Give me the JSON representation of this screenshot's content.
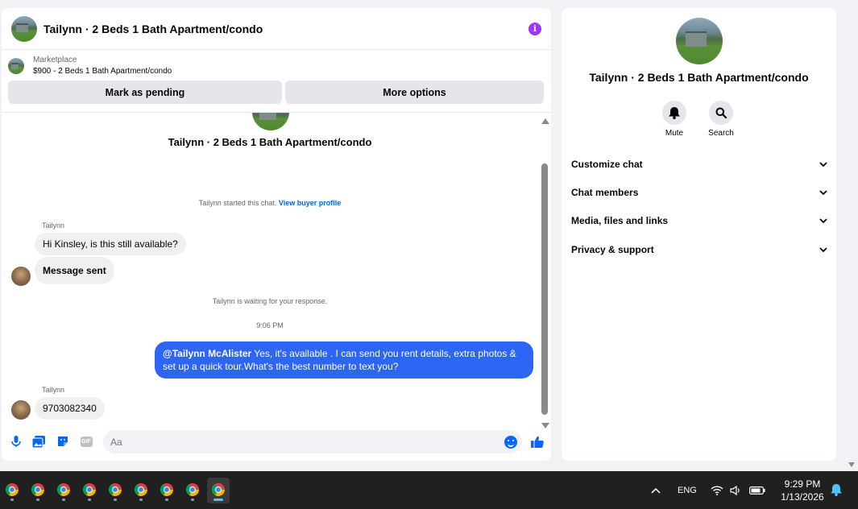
{
  "chat": {
    "title": "Tailynn · 2 Beds 1 Bath Apartment/condo",
    "info_icon": "info-icon",
    "marketplace_label": "Marketplace",
    "listing": "$900 - 2 Beds 1 Bath Apartment/condo",
    "mark_pending": "Mark as pending",
    "more_options": "More options"
  },
  "thread": {
    "title": "Tailynn · 2 Beds 1 Bath Apartment/condo",
    "started_text": "Tailynn started this chat.",
    "view_profile": "View buyer profile",
    "messages": [
      {
        "sender": "Tailynn",
        "text": "Hi Kinsley, is this still available?"
      },
      {
        "text": "Message sent"
      }
    ],
    "waiting_text": "Tailynn is waiting for your response.",
    "time": "9:06 PM",
    "outgoing": {
      "mention": "@Tailynn McAlister",
      "text": " Yes, it's available .  I can send you rent details, extra photos & set up a quick tour.What's the best number to text you?"
    },
    "reply_sender": "Tailynn",
    "reply_text": "9703082340"
  },
  "composer": {
    "placeholder": "Aa",
    "icons": [
      "microphone-icon",
      "photo-icon",
      "sticker-icon",
      "gif-icon",
      "emoji-icon",
      "thumbs-up-icon"
    ],
    "gif_label": "GIF"
  },
  "info_panel": {
    "title": "Tailynn · 2 Beds 1 Bath Apartment/condo",
    "mute_label": "Mute",
    "search_label": "Search",
    "sections": [
      "Customize chat",
      "Chat members",
      "Media, files and links",
      "Privacy & support"
    ]
  },
  "taskbar": {
    "app_count": 9,
    "language": "ENG",
    "time": "9:29 PM",
    "date": "1/13/2026"
  },
  "colors": {
    "accent": "#0866ff",
    "outgoing_bubble": "#2d66f5",
    "info": "#a033ff"
  }
}
